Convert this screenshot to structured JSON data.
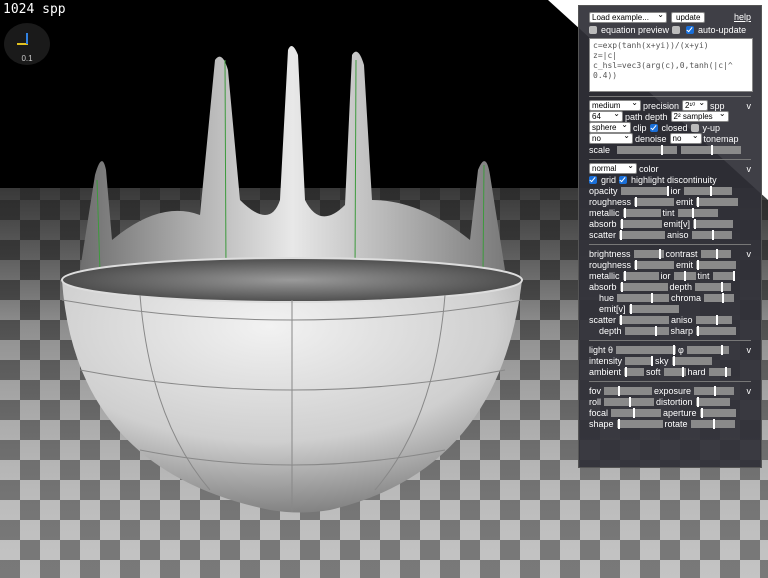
{
  "status": {
    "spp": "1024 spp",
    "gizmo_value": "0.1"
  },
  "top": {
    "load_example": "Load example...",
    "update": "update",
    "help": "help",
    "eq_preview": "equation preview",
    "auto_update": "auto-update"
  },
  "equation": {
    "lines": [
      "c=exp(tanh(x+yi))/(x+yi)",
      "z=|c|",
      "c_hsl=vec3(arg(c),0,tanh(|c|^",
      "0.4))"
    ]
  },
  "render": {
    "precision_value": "medium",
    "precision_label": "precision",
    "spp_value": "2¹⁰",
    "spp_label": "spp",
    "path_depth_value": "64",
    "path_depth_label": "path depth",
    "samples_value": "2² samples",
    "clip_value": "sphere",
    "clip_label": "clip",
    "closed_label": "closed",
    "yup_label": "y-up",
    "denoise_value": "no",
    "denoise_label": "denoise",
    "tonemap_value": "no",
    "tonemap_label": "tonemap",
    "scale_label": "scale",
    "caret": "v"
  },
  "surface": {
    "color_value": "normal",
    "color_label": "color",
    "grid_label": "grid",
    "highlight_label": "highlight discontinuity",
    "opacity": "opacity",
    "ior": "ior",
    "roughness": "roughness",
    "emit": "emit",
    "metallic": "metallic",
    "tint": "tint",
    "absorb": "absorb",
    "emit_v": "emit[v]",
    "scatter": "scatter",
    "aniso": "aniso",
    "caret": "v"
  },
  "volume": {
    "brightness": "brightness",
    "contrast": "contrast",
    "roughness": "roughness",
    "emit": "emit",
    "metallic": "metallic",
    "ior": "ior",
    "tint": "tint",
    "absorb": "absorb",
    "depth": "depth",
    "hue": "hue",
    "chroma": "chroma",
    "emit_v": "emit[v]",
    "scatter": "scatter",
    "aniso": "aniso",
    "depth2": "depth",
    "sharp": "sharp",
    "caret": "v"
  },
  "light": {
    "light_theta": "light θ",
    "phi": "φ",
    "intensity": "intensity",
    "sky": "sky",
    "ambient": "ambient",
    "soft": "soft",
    "hard": "hard",
    "caret": "v"
  },
  "camera": {
    "fov": "fov",
    "exposure": "exposure",
    "roll": "roll",
    "distortion": "distortion",
    "focal": "focal",
    "aperture": "aperture",
    "shape": "shape",
    "rotate": "rotate",
    "caret": "v"
  }
}
